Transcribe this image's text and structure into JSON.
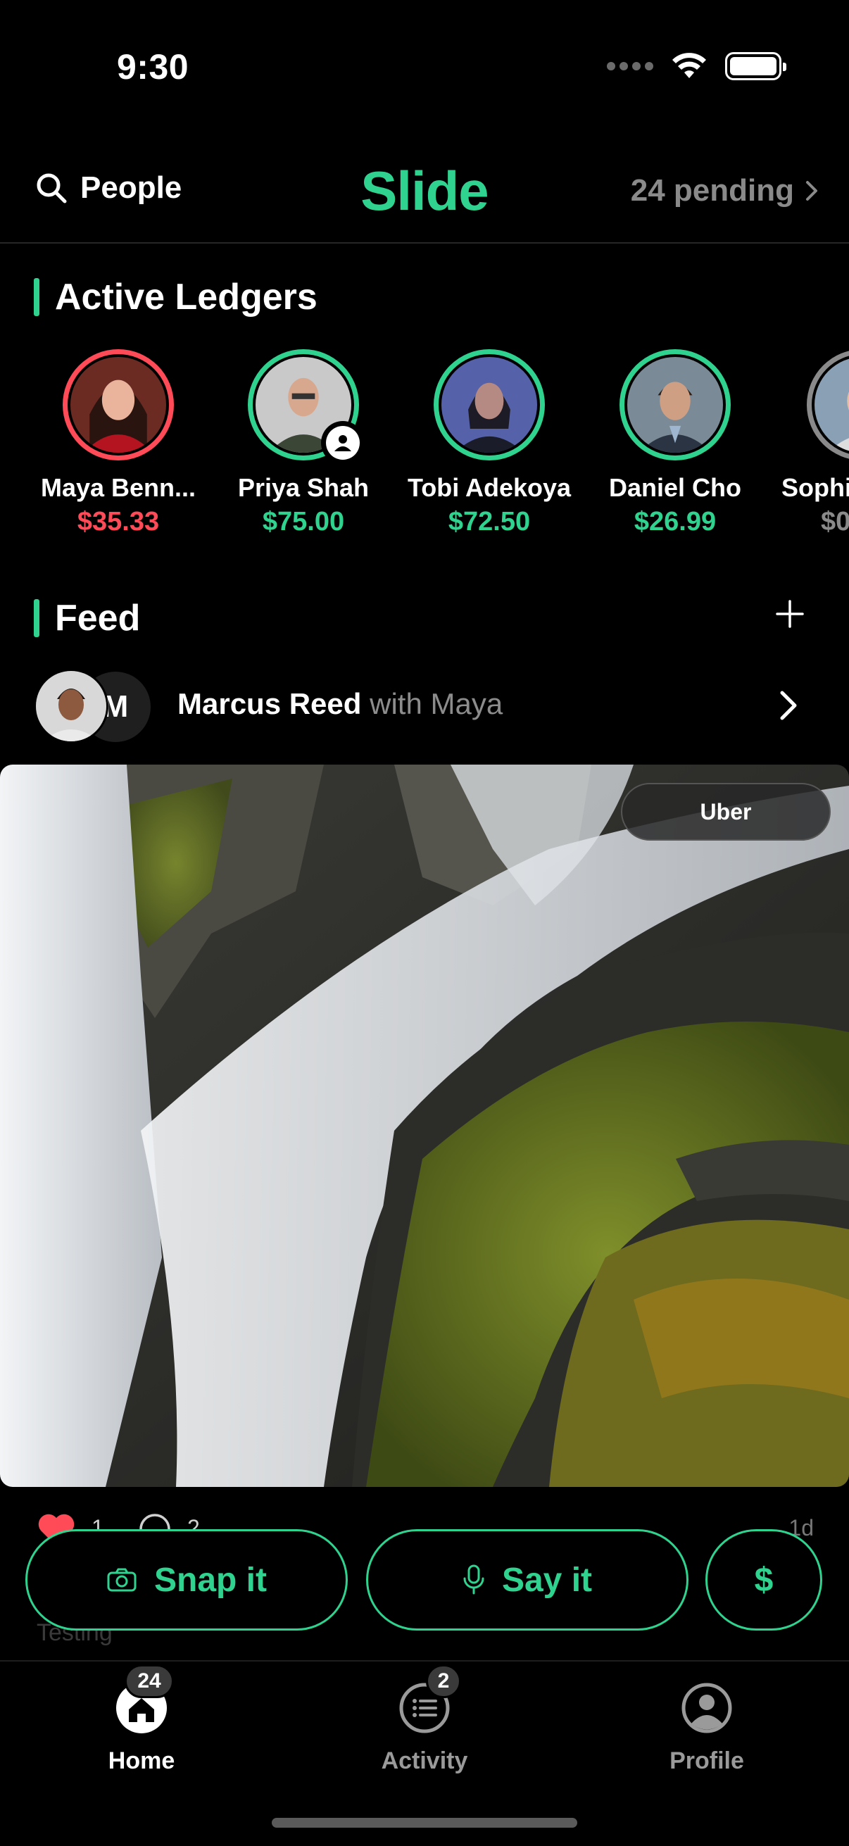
{
  "status_bar": {
    "time": "9:30"
  },
  "header": {
    "people_label": "People",
    "logo": "Slide",
    "pending_label": "24 pending"
  },
  "ledgers_section": {
    "title": "Active Ledgers",
    "items": [
      {
        "name": "Maya Benn...",
        "amount": "$35.33",
        "status_color": "#ff4a57"
      },
      {
        "name": "Priya Shah",
        "amount": "$75.00",
        "status_color": "#2fd28e"
      },
      {
        "name": "Tobi Adekoya",
        "amount": "$72.50",
        "status_color": "#2fd28e"
      },
      {
        "name": "Daniel Cho",
        "amount": "$26.99",
        "status_color": "#2fd28e"
      },
      {
        "name": "Sophi",
        "amount": "$0",
        "status_color": "#8a8a8a"
      }
    ]
  },
  "feed_section": {
    "title": "Feed",
    "post": {
      "author": "Marcus Reed",
      "with_text": "with Maya",
      "secondary_initial": "M",
      "tag": "Uber",
      "likes": "1",
      "comments": "2",
      "time_ago": "1d",
      "caption": "Testing"
    }
  },
  "actions": {
    "snap_label": "Snap it",
    "say_label": "Say it",
    "pay_label": "$"
  },
  "tabbar": {
    "items": [
      {
        "label": "Home",
        "badge": "24",
        "active": true
      },
      {
        "label": "Activity",
        "badge": "2",
        "active": false
      },
      {
        "label": "Profile",
        "badge": "",
        "active": false
      }
    ]
  },
  "colors": {
    "accent": "#2fd28e",
    "negative": "#ff4a57",
    "muted": "#8a8a8a"
  },
  "icons": [
    "search-icon",
    "chevron-right-icon",
    "plus-icon",
    "person-badge-icon",
    "heart-icon",
    "comment-icon",
    "camera-icon",
    "mic-icon",
    "home-icon",
    "activity-icon",
    "profile-icon",
    "wifi-icon",
    "battery-icon",
    "signal-icon"
  ]
}
